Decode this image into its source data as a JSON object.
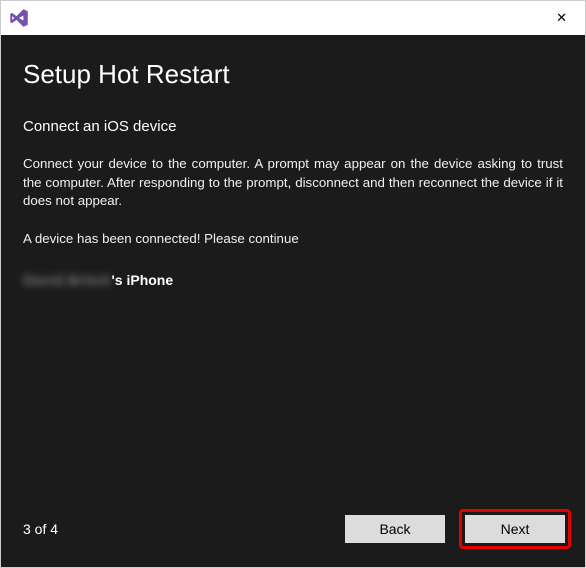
{
  "titlebar": {
    "icon_name": "visual-studio-icon"
  },
  "page": {
    "title": "Setup Hot Restart",
    "subtitle": "Connect an iOS device",
    "instructions": "Connect your device to the computer. A prompt may appear on the device asking to trust the computer. After responding to the prompt, disconnect and then reconnect the device if it does not appear.",
    "status": "A device has been connected! Please continue",
    "device_blurred": "David Britch",
    "device_suffix": "'s iPhone"
  },
  "footer": {
    "page_indicator": "3 of 4",
    "back_label": "Back",
    "next_label": "Next"
  }
}
